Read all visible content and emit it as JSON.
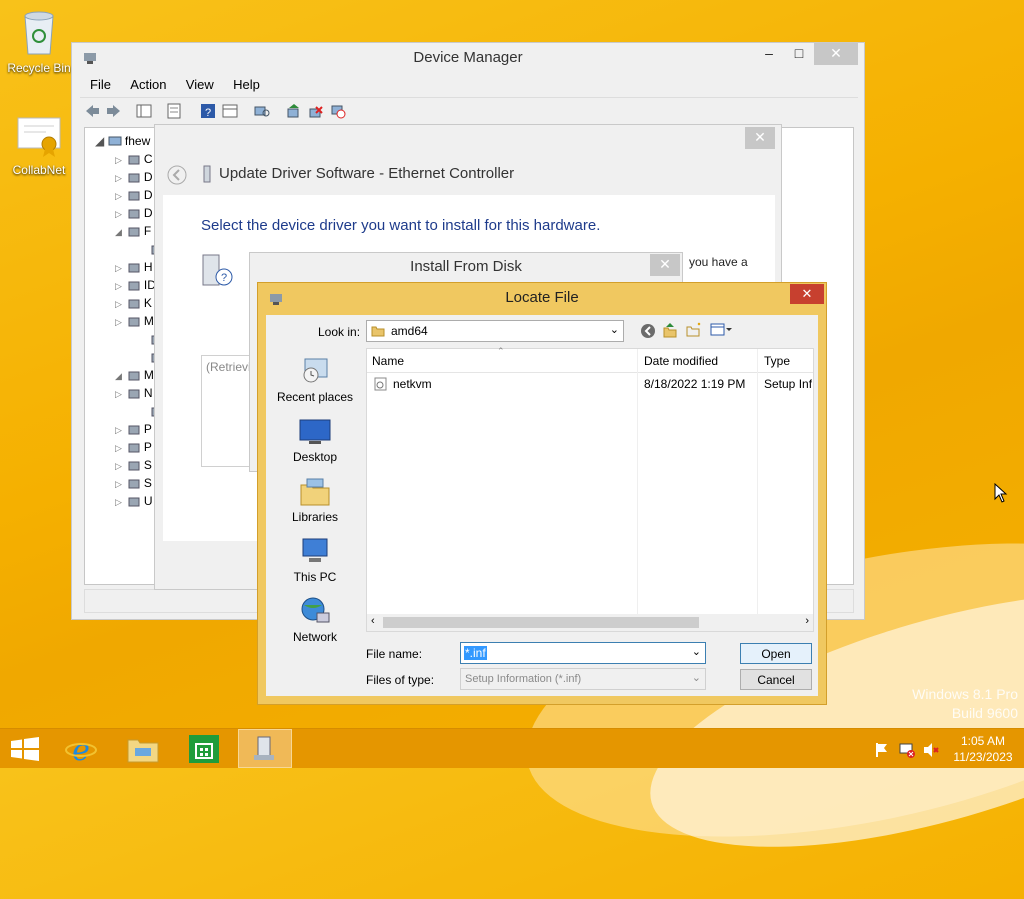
{
  "desktop": {
    "icons": [
      {
        "label": "Recycle Bin"
      },
      {
        "label": "CollabNet"
      }
    ],
    "watermark": {
      "line1": "Windows 8.1 Pro",
      "line2": "Build 9600"
    }
  },
  "device_manager": {
    "title": "Device Manager",
    "menu": [
      "File",
      "Action",
      "View",
      "Help"
    ],
    "tree_root": "fhew",
    "tree_letters": [
      "C",
      "D",
      "D",
      "D",
      "F",
      "",
      "H",
      "ID",
      "K",
      "M",
      "",
      "",
      "M",
      "N",
      "",
      "P",
      "P",
      "S",
      "S",
      "U"
    ]
  },
  "update_driver": {
    "title": "Update Driver Software - Ethernet Controller",
    "heading": "Select the device driver you want to install for this hardware.",
    "side_text": "you have a",
    "retrieving": "(Retrievi"
  },
  "install_from_disk": {
    "title": "Install From Disk"
  },
  "locate_file": {
    "title": "Locate File",
    "look_in_label": "Look in:",
    "look_in_value": "amd64",
    "places": [
      "Recent places",
      "Desktop",
      "Libraries",
      "This PC",
      "Network"
    ],
    "columns": [
      "Name",
      "Date modified",
      "Type"
    ],
    "rows": [
      {
        "name": "netkvm",
        "date": "8/18/2022 1:19 PM",
        "type": "Setup Info"
      }
    ],
    "file_name_label": "File name:",
    "file_name_value": "*.inf",
    "files_of_type_label": "Files of type:",
    "files_of_type_value": "Setup Information (*.inf)",
    "open_label": "Open",
    "cancel_label": "Cancel"
  },
  "taskbar": {
    "time": "1:05 AM",
    "date": "11/23/2023"
  }
}
